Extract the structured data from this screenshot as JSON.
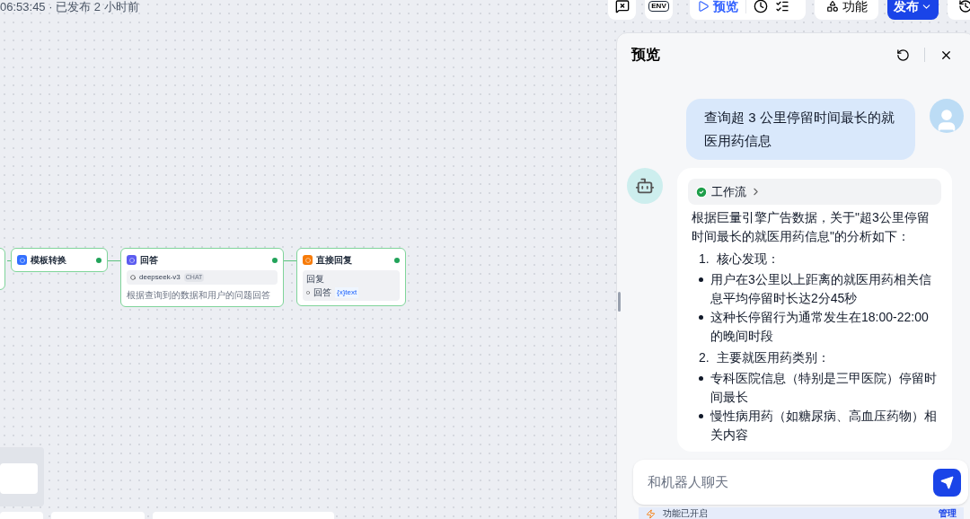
{
  "header": {
    "status": "06:53:45 · 已发布 2 小时前"
  },
  "toolbar": {
    "env_label": "ENV",
    "preview_button": "预览",
    "features_button": "功能",
    "publish_button": "发布"
  },
  "canvas": {
    "nodes": [
      {
        "kind": "simple",
        "title": "模板转换",
        "color": "#3370ff"
      },
      {
        "kind": "llm",
        "title": "回答",
        "color": "#5b5cf0",
        "model": "deepseek-v3",
        "model_tag": "CHAT",
        "description": "根据查询到的数据和用户的问题回答"
      },
      {
        "kind": "reply",
        "title": "直接回复",
        "color": "#f77b08",
        "field_label": "回复",
        "var_source": "回答",
        "var_name": "{x}text"
      }
    ]
  },
  "preview": {
    "title": "预览",
    "messages": [
      {
        "kind": "user",
        "text": "查询超 3 公里停留时间最长的就医用药信息"
      },
      {
        "kind": "bot",
        "workflow": {
          "label": "工作流",
          "done": true
        },
        "intro": "根据巨量引擎广告数据，关于\"超3公里停留时间最长的就医用药信息\"的分析如下：",
        "list": [
          {
            "number": "1.",
            "heading": "核心发现：",
            "bullets": [
              "用户在3公里以上距离的就医用药相关信息平均停留时长达2分45秒",
              "这种长停留行为通常发生在18:00-22:00的晚间时段"
            ]
          },
          {
            "number": "2.",
            "heading": "主要就医用药类别：",
            "bullets": [
              "专科医院信息（特别是三甲医院）停留时间最长",
              "慢性病用药（如糖尿病、高血压药物）相关内容"
            ]
          }
        ]
      }
    ],
    "input": {
      "placeholder": "和机器人聊天"
    },
    "footer": {
      "text": "功能已开启",
      "link": "管理"
    }
  }
}
